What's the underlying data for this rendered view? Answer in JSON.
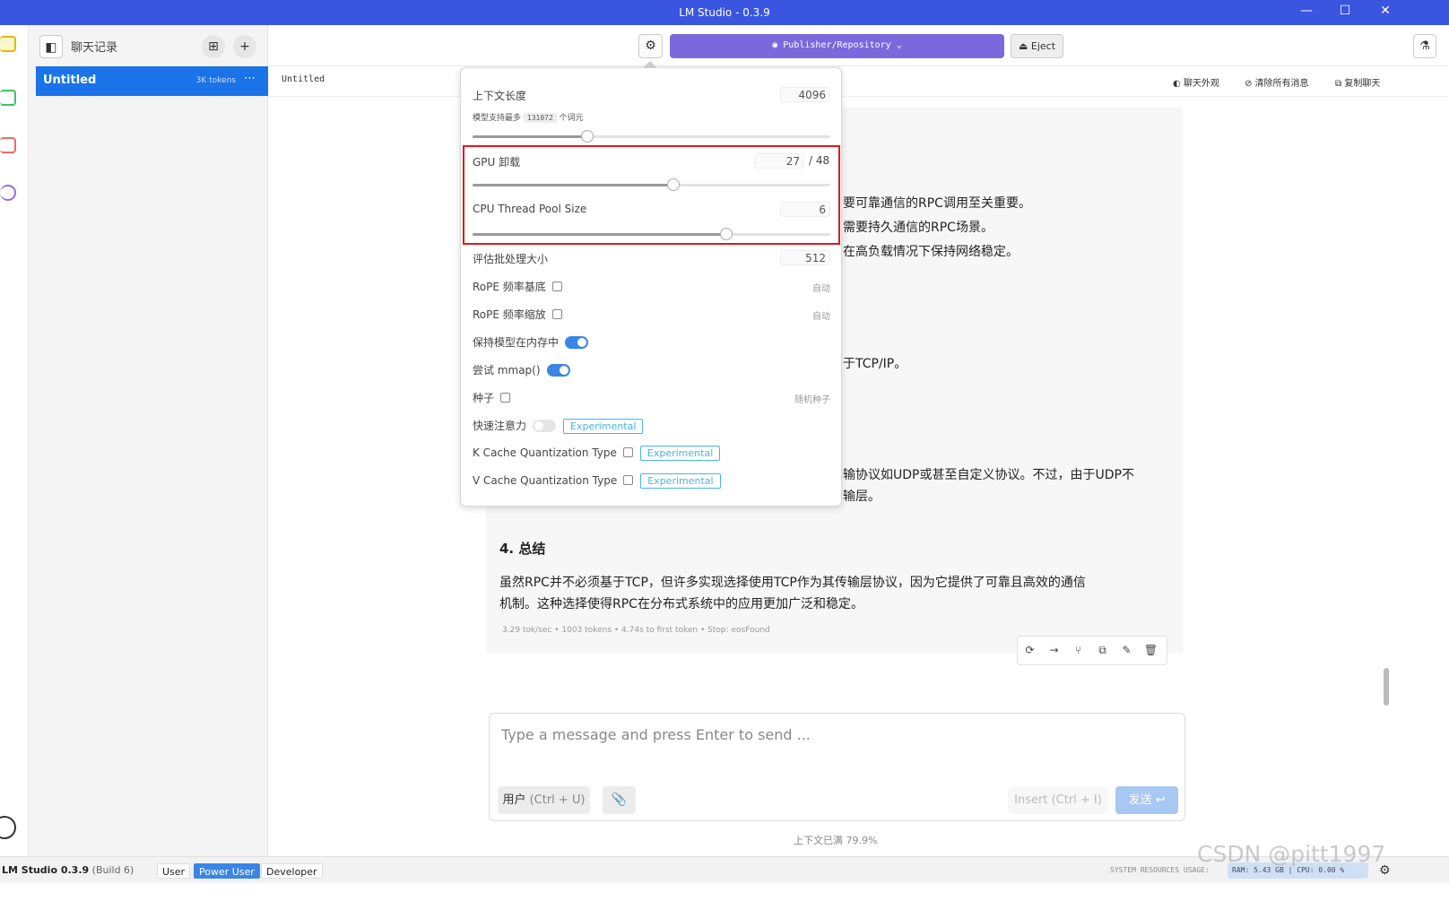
{
  "window": {
    "title": "LM Studio - 0.3.9",
    "minimize": "—",
    "maximize": "☐",
    "close": "✕"
  },
  "chatlist": {
    "header_label": "聊天记录",
    "item_title": "Untitled",
    "item_tokens": "3K tokens",
    "item_menu": "⋯"
  },
  "topbar": {
    "model_label": "Publisher/Repository",
    "eject_label": "Eject"
  },
  "subbar": {
    "chat_name": "Untitled",
    "appearance": "聊天外观",
    "clear_all": "清除所有消息",
    "copy_chat": "复制聊天"
  },
  "message": {
    "lines": [
      "要可靠通信的RPC调用至关重要。",
      "需要持久通信的RPC场景。",
      "在高负载情况下保持网络稳定。",
      "于TCP/IP。",
      "输协议如UDP或甚至自定义协议。不过，由于UDP不",
      "输层。"
    ],
    "heading": "4. 总结",
    "para1": "虽然RPC并不必须基于TCP，但许多实现选择使用TCP作为其传输层协议，因为它提供了可靠且高效的通信",
    "para2": "机制。这种选择使得RPC在分布式系统中的应用更加广泛和稳定。",
    "stats": "3.29 tok/sec • 1003 tokens • 4.74s to first token • Stop: eosFound"
  },
  "composer": {
    "placeholder": "Type a message and press Enter to send ...",
    "role_label": "用户",
    "role_shortcut": "(Ctrl + U)",
    "insert_label": "Insert (Ctrl + I)",
    "send_label": "发送 ↩"
  },
  "context_full": "上下文已满 79.9%",
  "settings": {
    "context_length": {
      "label": "上下文长度",
      "value": "4096",
      "hint_prefix": "模型支持最多",
      "hint_max": "131072",
      "hint_suffix": "个词元",
      "fraction": 0.32
    },
    "gpu_offload": {
      "label": "GPU 卸载",
      "value": "27",
      "max": "/ 48",
      "fraction": 0.5625
    },
    "cpu_threads": {
      "label": "CPU Thread Pool Size",
      "value": "6",
      "fraction": 0.71
    },
    "eval_batch": {
      "label": "评估批处理大小",
      "value": "512"
    },
    "rope_base": {
      "label": "RoPE 频率基底",
      "right": "自动"
    },
    "rope_scale": {
      "label": "RoPE 频率缩放",
      "right": "自动"
    },
    "keep_in_memory": {
      "label": "保持模型在内存中",
      "on": true
    },
    "mmap": {
      "label": "尝试 mmap()",
      "on": true
    },
    "seed": {
      "label": "种子",
      "right": "随机种子"
    },
    "flash_attention": {
      "label": "快速注意力",
      "tag": "Experimental",
      "on": false
    },
    "k_cache": {
      "label": "K Cache Quantization Type",
      "tag": "Experimental"
    },
    "v_cache": {
      "label": "V Cache Quantization Type",
      "tag": "Experimental"
    }
  },
  "statusbar": {
    "app_name": "LM Studio 0.3.9",
    "build": "(Build 6)",
    "modes": [
      "User",
      "Power User",
      "Developer"
    ],
    "active_mode": "Power User",
    "sys_label": "SYSTEM RESOURCES USAGE:",
    "resources": "RAM: 5.43 GB | CPU: 0.00 %"
  },
  "watermark": "CSDN @pitt1997",
  "colors": {
    "title_bar": "#3a55e0",
    "model_button": "#7b68dc",
    "active_chat": "#1a73e8",
    "highlight_box": "#d91c1c"
  }
}
